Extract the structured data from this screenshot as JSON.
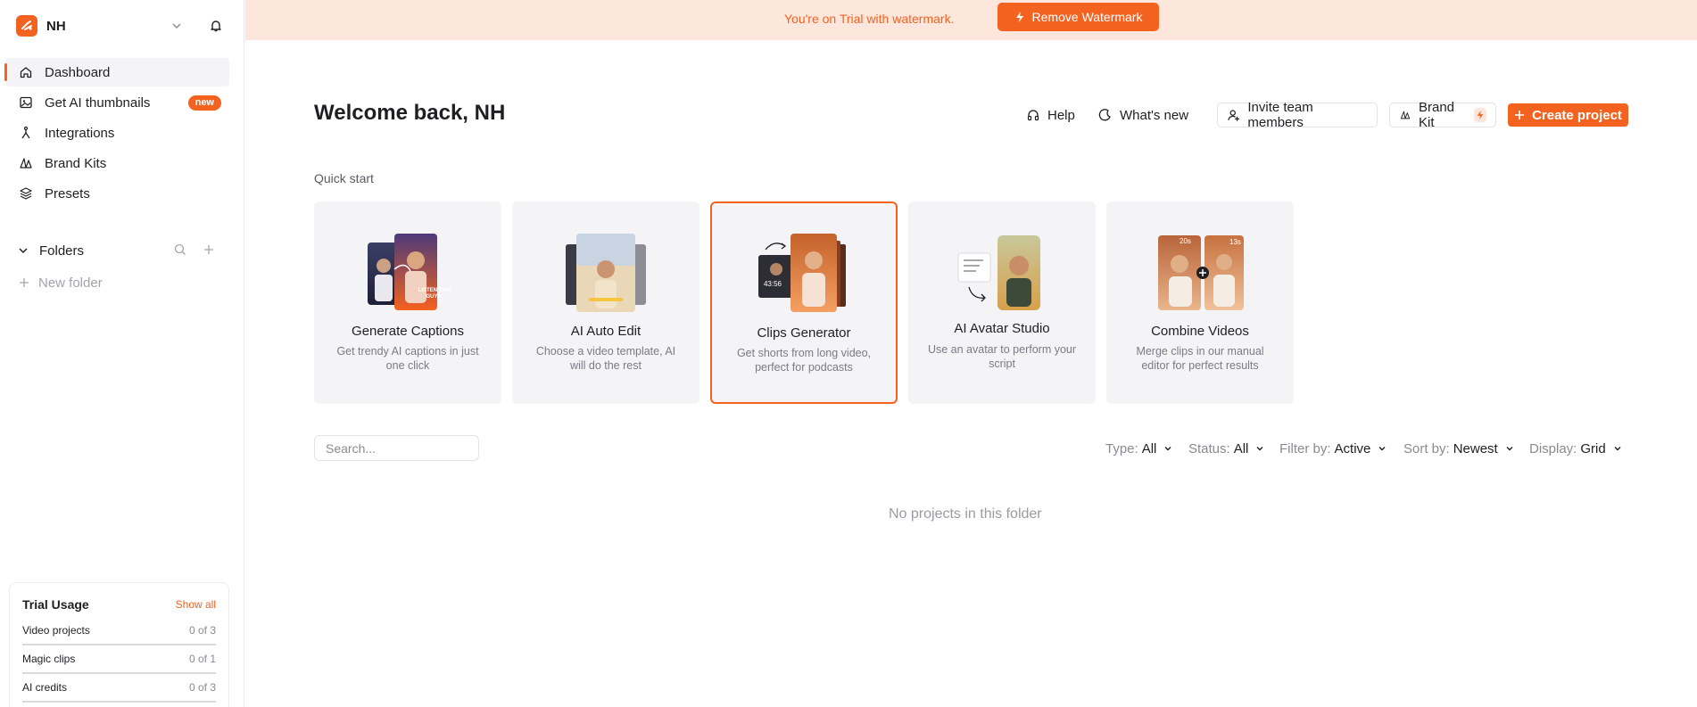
{
  "workspace": {
    "name": "NH"
  },
  "sidebar": {
    "items": [
      {
        "label": "Dashboard",
        "icon": "home-icon",
        "active": true
      },
      {
        "label": "Get AI thumbnails",
        "icon": "image-icon",
        "badge": "new"
      },
      {
        "label": "Integrations",
        "icon": "integrations-icon"
      },
      {
        "label": "Brand Kits",
        "icon": "brand-kit-icon"
      },
      {
        "label": "Presets",
        "icon": "layers-icon"
      }
    ],
    "folders_label": "Folders",
    "new_folder_label": "New folder"
  },
  "trial_usage": {
    "title": "Trial Usage",
    "show_all": "Show all",
    "rows": [
      {
        "label": "Video projects",
        "value": "0 of 3"
      },
      {
        "label": "Magic clips",
        "value": "0 of 1"
      },
      {
        "label": "AI credits",
        "value": "0 of 3"
      }
    ]
  },
  "banner": {
    "text": "You're on Trial with watermark.",
    "button": "Remove Watermark"
  },
  "header": {
    "title": "Welcome back, NH",
    "help": "Help",
    "whats_new": "What's new",
    "invite": "Invite team members",
    "brand_kit": "Brand Kit",
    "create": "Create project"
  },
  "quick_start": {
    "label": "Quick start",
    "cards": [
      {
        "title": "Generate Captions",
        "desc": "Get trendy AI captions in just one click",
        "overlay": "LISTEN THIS GUYS!"
      },
      {
        "title": "AI Auto Edit",
        "desc": "Choose a video template, AI will do the rest"
      },
      {
        "title": "Clips Generator",
        "desc": "Get shorts from long video, perfect for podcasts",
        "overlay": "43:56"
      },
      {
        "title": "AI Avatar Studio",
        "desc": "Use an avatar to perform your script"
      },
      {
        "title": "Combine Videos",
        "desc": "Merge clips in our manual editor for perfect results",
        "overlay_a": "20s",
        "overlay_b": "13s"
      }
    ]
  },
  "projects": {
    "search_placeholder": "Search...",
    "filters": [
      {
        "label": "Type:",
        "value": "All"
      },
      {
        "label": "Status:",
        "value": "All"
      },
      {
        "label": "Filter by:",
        "value": "Active"
      },
      {
        "label": "Sort by:",
        "value": "Newest"
      },
      {
        "label": "Display:",
        "value": "Grid"
      }
    ],
    "empty_text": "No projects in this folder"
  },
  "colors": {
    "accent": "#f4621f",
    "banner_bg": "#fde6dc",
    "card_bg": "#f4f4f7"
  }
}
